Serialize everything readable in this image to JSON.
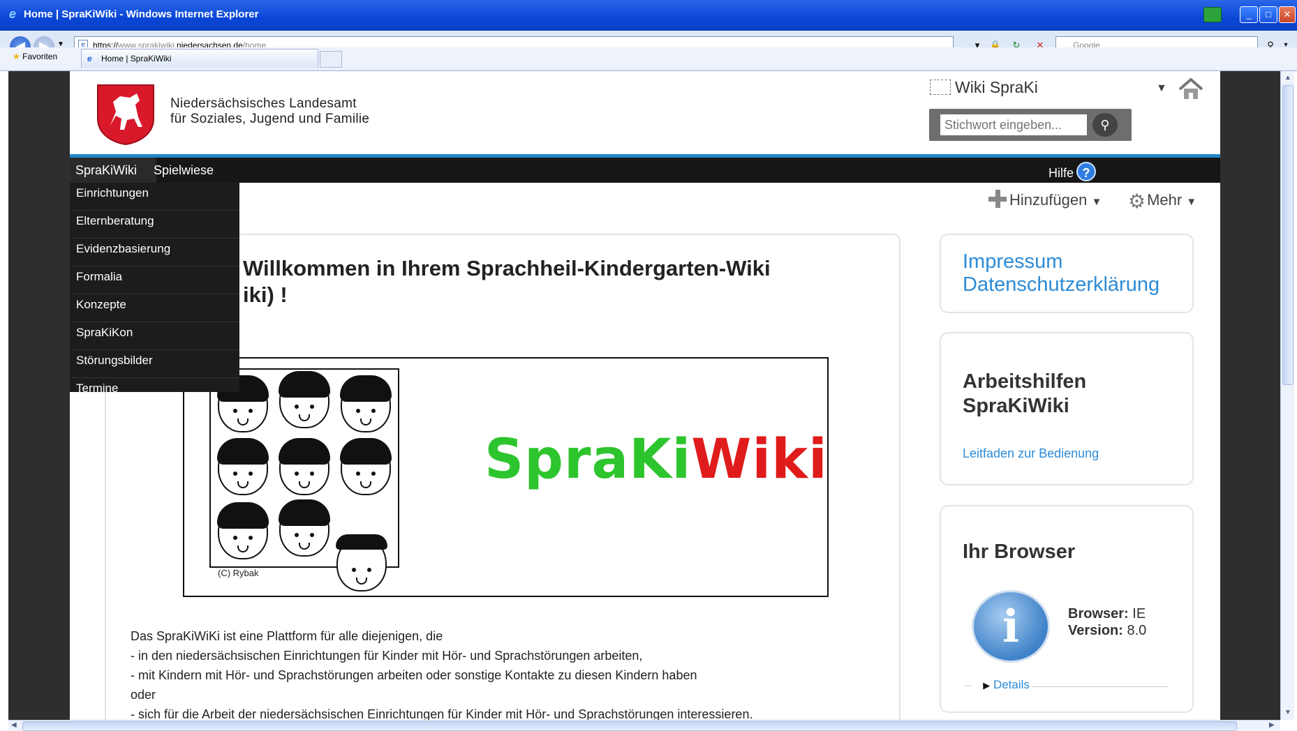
{
  "window": {
    "title": "Home | SpraKiWiki - Windows Internet Explorer"
  },
  "addressbar": {
    "url_prefix": "https://",
    "url_host_gray": "www.sprakiwiki.",
    "url_host": "niedersachsen.de",
    "url_path": "/home",
    "search_placeholder": "Google"
  },
  "favorites": {
    "label": "Favoriten",
    "tab_title": "Home | SpraKiWiki"
  },
  "header": {
    "org_line1": "Niedersächsisches Landesamt",
    "org_line2": "für Soziales, Jugend und Familie",
    "site_title": "Wiki SpraKi",
    "search_placeholder": "Stichwort eingeben..."
  },
  "menu": {
    "items": [
      "SpraKiWiki",
      "Spielwiese"
    ],
    "help": "Hilfe",
    "help_icon": "?",
    "submenu": [
      "Einrichtungen",
      "Elternberatung",
      "Evidenzbasierung",
      "Formalia",
      "Konzepte",
      "SpraKiKon",
      "Störungsbilder",
      "Termine"
    ]
  },
  "actions": {
    "add": "Hinzufügen",
    "more": "Mehr"
  },
  "main": {
    "welcome_line1": "Willkommen in Ihrem Sprachheil-Kindergarten-Wiki",
    "welcome_line2": "iki) !",
    "banner_credit": "(C) Rybak",
    "logo_green": "SpraKi",
    "logo_red": "Wiki",
    "paragraphs": [
      "Das SpraKiWiKi ist eine Plattform für alle diejenigen, die",
      "- in den niedersächsischen Einrichtungen für Kinder mit Hör- und Sprachstörungen arbeiten,",
      "- mit Kindern mit Hör- und Sprachstörungen arbeiten oder sonstige Kontakte zu diesen Kindern haben",
      "oder",
      "- sich für die Arbeit der niedersächsischen Einrichtungen für Kinder mit Hör- und Sprachstörungen interessieren."
    ]
  },
  "sidebar": {
    "impressum": "Impressum",
    "datenschutz": "Datenschutzerklärung",
    "arbeitshilfen_title_1": "Arbeitshilfen",
    "arbeitshilfen_title_2": "SpraKiWiki",
    "leitfaden": "Leitfaden zur Bedienung",
    "browser_title": "Ihr Browser",
    "browser_label": "Browser:",
    "browser_value": "IE",
    "version_label": "Version:",
    "version_value": "8.0",
    "details": "Details",
    "info_glyph": "i"
  },
  "colors": {
    "accent_blue": "#2288c8",
    "link_blue": "#2d8bd6",
    "menubar": "#161616",
    "logo_green": "#2dc52d",
    "logo_red": "#e01b1b"
  }
}
